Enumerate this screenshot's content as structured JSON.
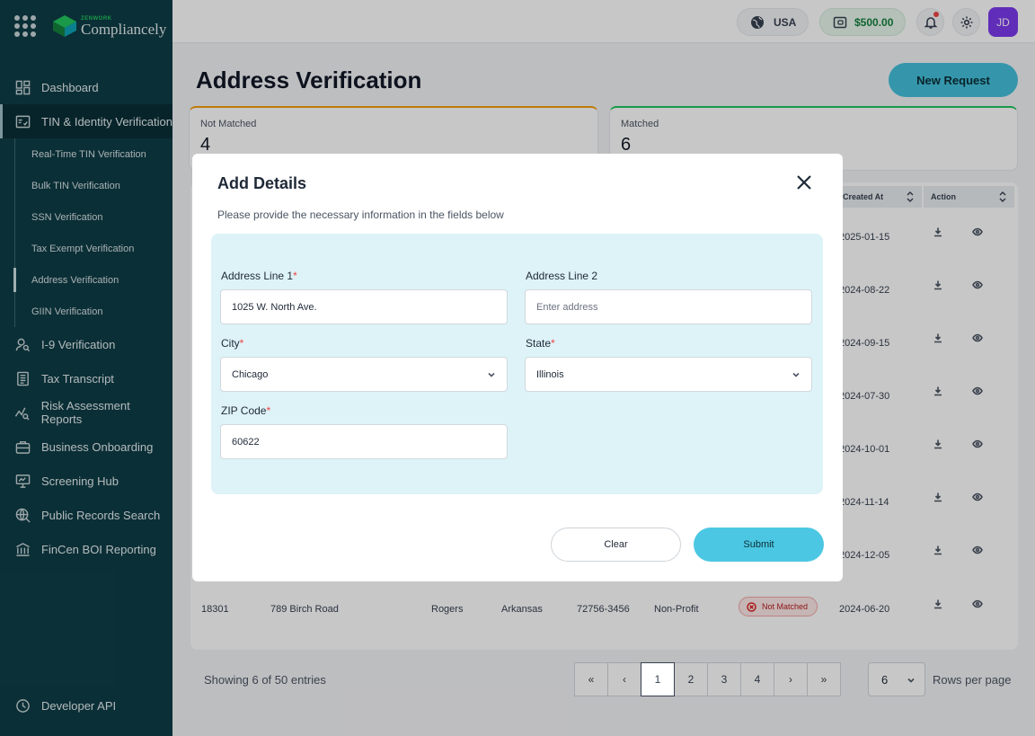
{
  "brand": {
    "small": "ZENWORK",
    "name": "Compliancely"
  },
  "sidebar": {
    "items": [
      {
        "label": "Dashboard",
        "icon": "dashboard-icon"
      },
      {
        "label": "TIN & Identity Verification",
        "icon": "id-card-icon"
      },
      {
        "label": "I-9 Verification",
        "icon": "user-search-icon"
      },
      {
        "label": "Tax Transcript",
        "icon": "document-icon"
      },
      {
        "label": "Risk Assessment Reports",
        "icon": "chart-search-icon"
      },
      {
        "label": "Business Onboarding",
        "icon": "briefcase-icon"
      },
      {
        "label": "Screening Hub",
        "icon": "monitor-icon"
      },
      {
        "label": "Public Records Search",
        "icon": "globe-search-icon"
      },
      {
        "label": "FinCen BOI Reporting",
        "icon": "bank-icon"
      }
    ],
    "sub_items": [
      {
        "label": "Real-Time TIN Verification"
      },
      {
        "label": "Bulk TIN Verification"
      },
      {
        "label": "SSN Verification"
      },
      {
        "label": "Tax Exempt Verification"
      },
      {
        "label": "Address Verification"
      },
      {
        "label": "GIIN Verification"
      }
    ],
    "bottom": {
      "label": "Developer API",
      "icon": "api-icon"
    }
  },
  "topbar": {
    "country": "USA",
    "balance": "$500.00",
    "avatar_initials": "JD"
  },
  "page": {
    "title": "Address Verification",
    "new_request_label": "New Request"
  },
  "stats": {
    "not_matched_label": "Not Matched",
    "not_matched_value": "4",
    "matched_label": "Matched",
    "matched_value": "6"
  },
  "table": {
    "headers": {
      "created_at": "Created At",
      "action": "Action"
    },
    "created_dates": [
      "2025-01-15",
      "2024-08-22",
      "2024-09-15",
      "2024-07-30",
      "2024-10-01",
      "2024-11-14",
      "2024-12-05"
    ],
    "last_row": {
      "id": "18301",
      "address": "789 Birch Road",
      "city": "Rogers",
      "state": "Arkansas",
      "zip": "72756-3456",
      "type": "Non-Profit",
      "status": "Not Matched",
      "created": "2024-06-20"
    }
  },
  "footer": {
    "showing": "Showing 6 of 50 entries",
    "pages": [
      "1",
      "2",
      "3",
      "4"
    ],
    "first": "«",
    "prev": "‹",
    "next": "›",
    "last": "»",
    "rows_value": "6",
    "rows_label": "Rows per page"
  },
  "modal": {
    "title": "Add Details",
    "subtitle": "Please provide the necessary information in the fields below",
    "address1_label": "Address Line 1",
    "address1_value": "1025 W. North Ave.",
    "address2_label": "Address Line 2",
    "address2_placeholder": "Enter address",
    "city_label": "City",
    "city_value": "Chicago",
    "state_label": "State",
    "state_value": "Illinois",
    "zip_label": "ZIP Code",
    "zip_value": "60622",
    "required_mark": "*",
    "clear_label": "Clear",
    "submit_label": "Submit"
  },
  "colors": {
    "sidebar_bg": "#0f3d46",
    "accent": "#4cc7e3",
    "form_bg": "#def3f8",
    "required": "#ef4444"
  }
}
